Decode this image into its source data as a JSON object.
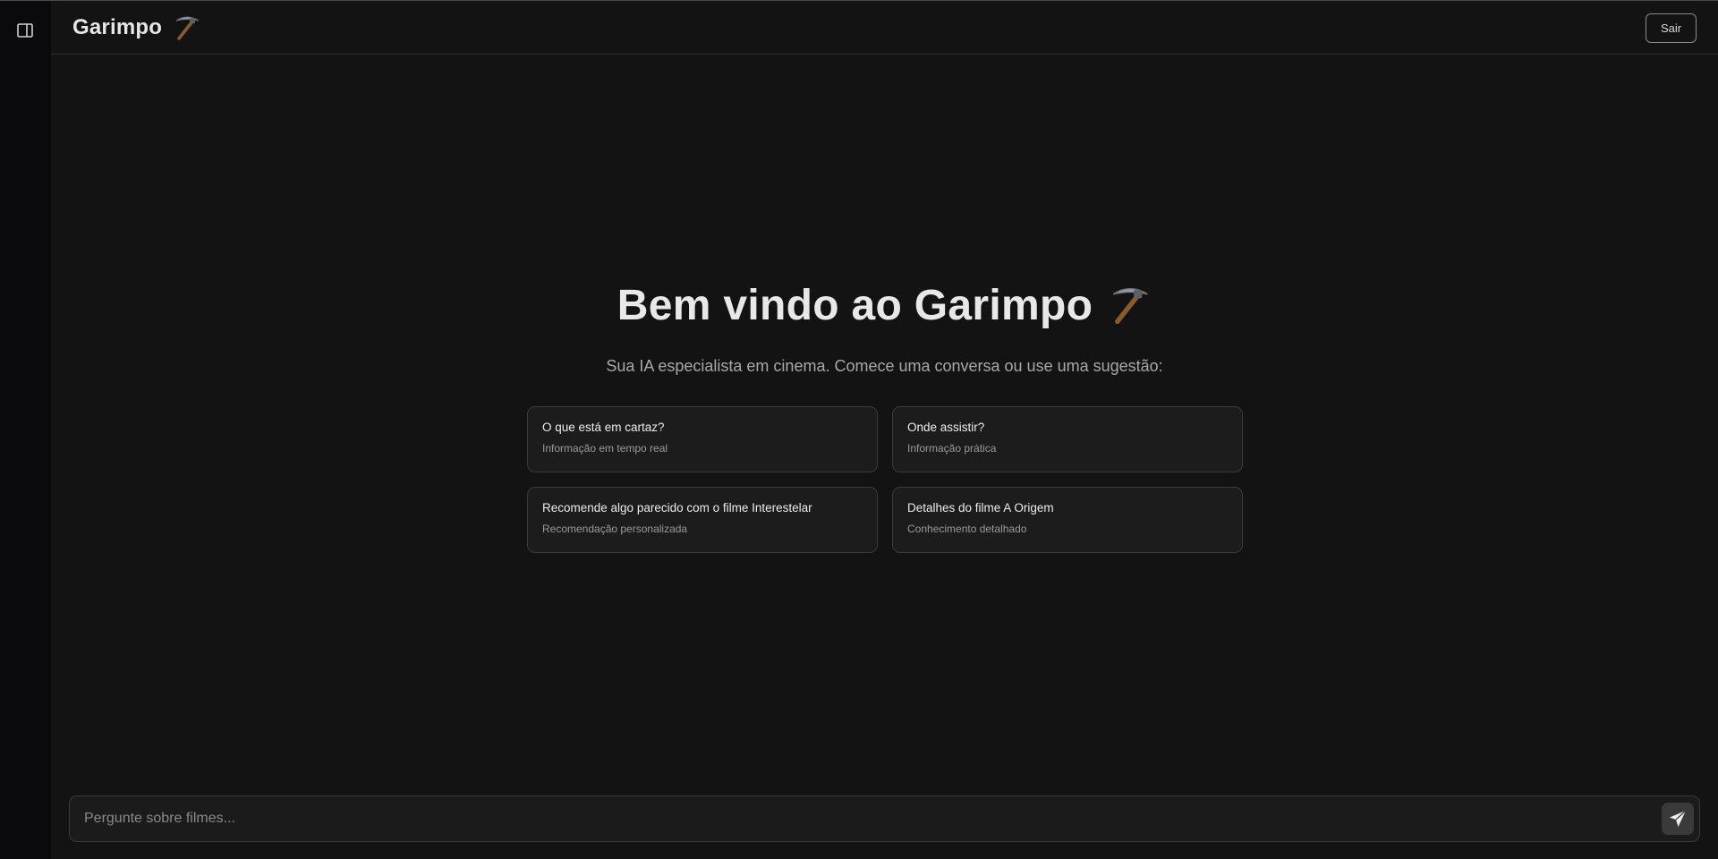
{
  "sidebar": {
    "toggle_icon": "sidebar-panel-icon"
  },
  "header": {
    "title": "Garimpo",
    "logo_icon": "pickaxe-icon",
    "logout_label": "Sair"
  },
  "welcome": {
    "title": "Bem vindo ao Garimpo",
    "subtitle": "Sua IA especialista em cinema. Comece uma conversa ou use uma sugestão:"
  },
  "suggestions": [
    {
      "title": "O que está em cartaz?",
      "subtitle": "Informação em tempo real"
    },
    {
      "title": "Onde assistir?",
      "subtitle": "Informação prática"
    },
    {
      "title": "Recomende algo parecido com o filme Interestelar",
      "subtitle": "Recomendação personalizada"
    },
    {
      "title": "Detalhes do filme A Origem",
      "subtitle": "Conhecimento detalhado"
    }
  ],
  "composer": {
    "placeholder": "Pergunte sobre filmes...",
    "send_icon": "send-icon"
  },
  "colors": {
    "background": "#131313",
    "sidebar": "#0a0a0e",
    "card": "#1c1c1c",
    "card_border": "#3a3a3a",
    "text": "#e8e8e8",
    "muted": "#a8a8a8"
  }
}
